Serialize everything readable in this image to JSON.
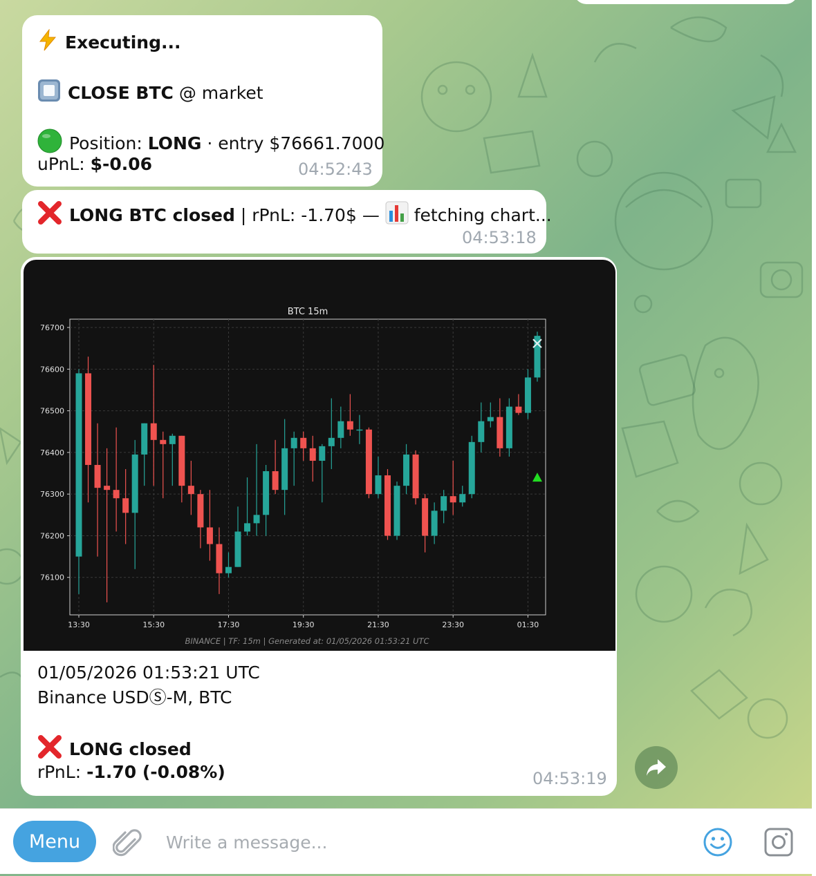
{
  "messages": {
    "m1": {
      "line1": "Executing...",
      "line2_bold": "CLOSE BTC",
      "line2_rest": " @ market",
      "line3_prefix": "Position: ",
      "line3_bold": "LONG",
      "line3_rest": " · entry $76661.7000",
      "line4_prefix": "uPnL: ",
      "line4_bold": "$-0.06",
      "time": "04:52:43"
    },
    "m2": {
      "bold": "LONG BTC  closed",
      "rest": " | rPnL: -1.70$ — ",
      "tail": " fetching chart...",
      "time": "04:53:18"
    },
    "m3": {
      "caption_line1": "01/05/2026 01:53:21 UTC",
      "caption_line2": "Binance USDⓈ-M, BTC",
      "closed_label": "LONG closed",
      "rpnl_prefix": "rPnL: ",
      "rpnl_bold": "-1.70 (-0.08%)",
      "time": "04:53:19"
    }
  },
  "chart_data": {
    "type": "candlestick",
    "title": "BTC 15m",
    "footer": "BINANCE | TF: 15m | Generated at: 01/05/2026 01:53:21 UTC",
    "ylim": [
      76010,
      76720
    ],
    "yticks": [
      76100,
      76200,
      76300,
      76400,
      76500,
      76600,
      76700
    ],
    "xticks": [
      "13:30",
      "15:30",
      "17:30",
      "19:30",
      "21:30",
      "23:30",
      "01:30"
    ],
    "up_color": "#26a69a",
    "down_color": "#ef5350",
    "candles": [
      {
        "o": 76150,
        "h": 76600,
        "l": 76060,
        "c": 76590
      },
      {
        "o": 76590,
        "h": 76630,
        "l": 76280,
        "c": 76370
      },
      {
        "o": 76370,
        "h": 76470,
        "l": 76150,
        "c": 76315
      },
      {
        "o": 76320,
        "h": 76410,
        "l": 76040,
        "c": 76310
      },
      {
        "o": 76310,
        "h": 76460,
        "l": 76210,
        "c": 76290
      },
      {
        "o": 76290,
        "h": 76360,
        "l": 76180,
        "c": 76255
      },
      {
        "o": 76255,
        "h": 76430,
        "l": 76120,
        "c": 76395
      },
      {
        "o": 76395,
        "h": 76470,
        "l": 76320,
        "c": 76470
      },
      {
        "o": 76470,
        "h": 76610,
        "l": 76320,
        "c": 76430
      },
      {
        "o": 76430,
        "h": 76450,
        "l": 76290,
        "c": 76420
      },
      {
        "o": 76420,
        "h": 76445,
        "l": 76320,
        "c": 76440
      },
      {
        "o": 76440,
        "h": 76440,
        "l": 76280,
        "c": 76320
      },
      {
        "o": 76320,
        "h": 76380,
        "l": 76250,
        "c": 76300
      },
      {
        "o": 76300,
        "h": 76310,
        "l": 76170,
        "c": 76220
      },
      {
        "o": 76220,
        "h": 76310,
        "l": 76140,
        "c": 76180
      },
      {
        "o": 76180,
        "h": 76220,
        "l": 76060,
        "c": 76110
      },
      {
        "o": 76110,
        "h": 76160,
        "l": 76100,
        "c": 76125
      },
      {
        "o": 76125,
        "h": 76270,
        "l": 76125,
        "c": 76210
      },
      {
        "o": 76210,
        "h": 76340,
        "l": 76200,
        "c": 76230
      },
      {
        "o": 76230,
        "h": 76420,
        "l": 76200,
        "c": 76250
      },
      {
        "o": 76250,
        "h": 76370,
        "l": 76200,
        "c": 76355
      },
      {
        "o": 76355,
        "h": 76430,
        "l": 76300,
        "c": 76310
      },
      {
        "o": 76310,
        "h": 76480,
        "l": 76250,
        "c": 76410
      },
      {
        "o": 76410,
        "h": 76450,
        "l": 76320,
        "c": 76435
      },
      {
        "o": 76435,
        "h": 76450,
        "l": 76380,
        "c": 76410
      },
      {
        "o": 76410,
        "h": 76440,
        "l": 76330,
        "c": 76380
      },
      {
        "o": 76380,
        "h": 76420,
        "l": 76280,
        "c": 76415
      },
      {
        "o": 76415,
        "h": 76530,
        "l": 76360,
        "c": 76435
      },
      {
        "o": 76435,
        "h": 76510,
        "l": 76410,
        "c": 76475
      },
      {
        "o": 76475,
        "h": 76540,
        "l": 76440,
        "c": 76455
      },
      {
        "o": 76455,
        "h": 76490,
        "l": 76420,
        "c": 76455
      },
      {
        "o": 76455,
        "h": 76460,
        "l": 76290,
        "c": 76300
      },
      {
        "o": 76300,
        "h": 76390,
        "l": 76290,
        "c": 76345
      },
      {
        "o": 76345,
        "h": 76360,
        "l": 76190,
        "c": 76200
      },
      {
        "o": 76200,
        "h": 76330,
        "l": 76190,
        "c": 76320
      },
      {
        "o": 76320,
        "h": 76420,
        "l": 76300,
        "c": 76395
      },
      {
        "o": 76395,
        "h": 76405,
        "l": 76275,
        "c": 76290
      },
      {
        "o": 76290,
        "h": 76300,
        "l": 76160,
        "c": 76200
      },
      {
        "o": 76200,
        "h": 76280,
        "l": 76180,
        "c": 76260
      },
      {
        "o": 76260,
        "h": 76310,
        "l": 76230,
        "c": 76295
      },
      {
        "o": 76295,
        "h": 76380,
        "l": 76250,
        "c": 76280
      },
      {
        "o": 76280,
        "h": 76320,
        "l": 76270,
        "c": 76300
      },
      {
        "o": 76300,
        "h": 76440,
        "l": 76290,
        "c": 76425
      },
      {
        "o": 76425,
        "h": 76520,
        "l": 76400,
        "c": 76475
      },
      {
        "o": 76475,
        "h": 76520,
        "l": 76460,
        "c": 76485
      },
      {
        "o": 76485,
        "h": 76530,
        "l": 76390,
        "c": 76410
      },
      {
        "o": 76410,
        "h": 76530,
        "l": 76390,
        "c": 76510
      },
      {
        "o": 76510,
        "h": 76540,
        "l": 76490,
        "c": 76495
      },
      {
        "o": 76495,
        "h": 76600,
        "l": 76480,
        "c": 76580
      },
      {
        "o": 76580,
        "h": 76690,
        "l": 76570,
        "c": 76680
      }
    ],
    "markers": [
      {
        "type": "x",
        "candle": 49,
        "price": 76661.7,
        "color": "#e0f0f0"
      },
      {
        "type": "triangle-up",
        "candle": 49,
        "price": 76340,
        "color": "#22dd22"
      }
    ]
  },
  "composer": {
    "menu_label": "Menu",
    "placeholder": "Write a message..."
  },
  "colors": {
    "bubble": "#ffffff",
    "menu_button": "#45a3e0",
    "timestamp": "#a0a8b0",
    "icon_blue": "#45a3e0"
  }
}
